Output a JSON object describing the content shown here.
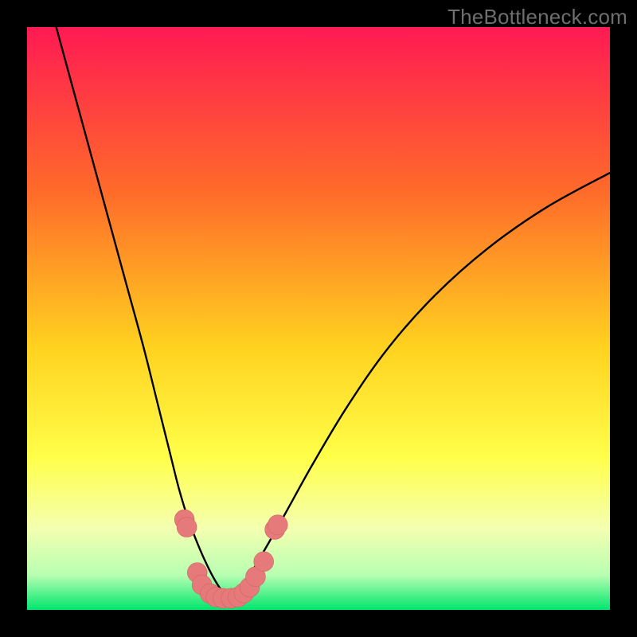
{
  "watermark": "TheBottleneck.com",
  "colors": {
    "frame": "#000000",
    "grad_top": "#ff1a53",
    "grad_mid1": "#ff6a2a",
    "grad_mid2": "#ffd21f",
    "grad_mid3": "#ffff4a",
    "grad_mid4": "#f4ffb0",
    "grad_mid5": "#b8ffb2",
    "grad_bottom": "#00e66e",
    "curve": "#000000",
    "marker_fill": "#e6797a",
    "marker_stroke": "#d26566"
  },
  "chart_data": {
    "type": "line",
    "title": "",
    "xlabel": "",
    "ylabel": "",
    "xlim": [
      0,
      100
    ],
    "ylim": [
      0,
      100
    ],
    "series": [
      {
        "name": "left-branch",
        "x": [
          5,
          8,
          11,
          14,
          17,
          20,
          22.5,
          24.5,
          26,
          27.5,
          29,
          30.5,
          32,
          33.5,
          35
        ],
        "y": [
          100,
          89,
          78,
          67,
          56,
          45,
          35,
          27,
          21,
          16,
          12,
          8.5,
          5.5,
          3.2,
          2
        ]
      },
      {
        "name": "right-branch",
        "x": [
          35,
          37,
          40,
          44,
          49,
          55,
          62,
          70,
          79,
          89,
          100
        ],
        "y": [
          2,
          4,
          9,
          16,
          25,
          35,
          45,
          54,
          62,
          69,
          75
        ]
      }
    ],
    "markers": [
      {
        "x": 27.0,
        "y": 15.5,
        "r": 1.7
      },
      {
        "x": 27.4,
        "y": 14.2,
        "r": 1.7
      },
      {
        "x": 29.2,
        "y": 6.4,
        "r": 1.7
      },
      {
        "x": 30.0,
        "y": 4.3,
        "r": 1.7
      },
      {
        "x": 31.4,
        "y": 2.8,
        "r": 1.7
      },
      {
        "x": 32.4,
        "y": 2.2,
        "r": 1.7
      },
      {
        "x": 33.6,
        "y": 2.0,
        "r": 1.7
      },
      {
        "x": 35.0,
        "y": 2.0,
        "r": 1.7
      },
      {
        "x": 36.2,
        "y": 2.2,
        "r": 1.7
      },
      {
        "x": 37.2,
        "y": 2.9,
        "r": 1.7
      },
      {
        "x": 38.2,
        "y": 3.9,
        "r": 1.7
      },
      {
        "x": 39.2,
        "y": 5.7,
        "r": 1.7
      },
      {
        "x": 40.6,
        "y": 8.3,
        "r": 1.7
      },
      {
        "x": 42.5,
        "y": 13.8,
        "r": 1.7
      },
      {
        "x": 43.0,
        "y": 14.6,
        "r": 1.7
      }
    ]
  }
}
